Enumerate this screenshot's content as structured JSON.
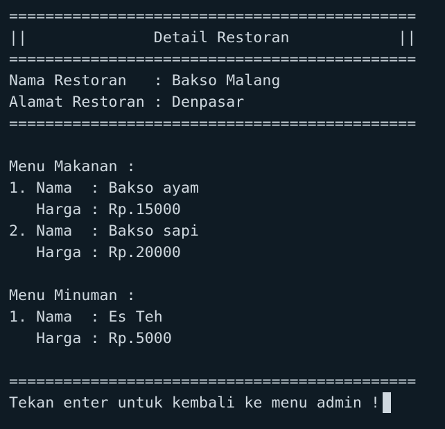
{
  "header": {
    "rule": "=============================================",
    "title_line": "||              Detail Restoran            ||"
  },
  "restaurant": {
    "name_line": "Nama Restoran   : Bakso Malang",
    "address_line": "Alamat Restoran : Denpasar"
  },
  "food_menu": {
    "heading": "Menu Makanan :",
    "items": [
      {
        "name_line": "1. Nama  : Bakso ayam",
        "price_line": "   Harga : Rp.15000"
      },
      {
        "name_line": "2. Nama  : Bakso sapi",
        "price_line": "   Harga : Rp.20000"
      }
    ]
  },
  "drink_menu": {
    "heading": "Menu Minuman :",
    "items": [
      {
        "name_line": "1. Nama  : Es Teh",
        "price_line": "   Harga : Rp.5000"
      }
    ]
  },
  "footer": {
    "prompt": "Tekan enter untuk kembali ke menu admin !"
  }
}
